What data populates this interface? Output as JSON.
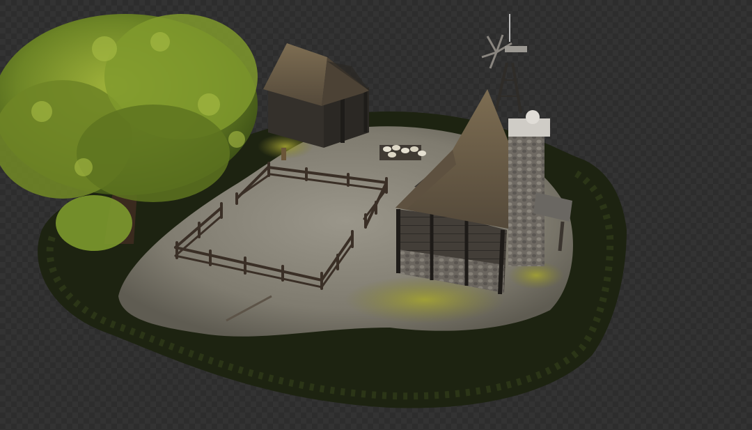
{
  "viewport": {
    "background": "transparency-checkerboard",
    "checker_colors": [
      "#2d2d2d",
      "#333333"
    ]
  },
  "scene": {
    "subject": "farmstead-diorama",
    "objects": [
      {
        "name": "oak-tree",
        "color": "#7a8f2a"
      },
      {
        "name": "hedge-border",
        "color": "#1e2412"
      },
      {
        "name": "stone-ground",
        "color": "#8f8b7e"
      },
      {
        "name": "moss-patch",
        "color": "#8c8a2c"
      },
      {
        "name": "barn-shed",
        "color": "#3a3530"
      },
      {
        "name": "thatched-roof",
        "color": "#6d5e45"
      },
      {
        "name": "wooden-fence",
        "color": "#3b3027"
      },
      {
        "name": "cottage",
        "color": "#45403a"
      },
      {
        "name": "stone-chimney",
        "color": "#76716a"
      },
      {
        "name": "windmill-tower",
        "color": "#4e4a45"
      },
      {
        "name": "sheep-flock",
        "color": "#e6e1d2"
      },
      {
        "name": "lean-to-roof",
        "color": "#6a6762"
      }
    ]
  }
}
